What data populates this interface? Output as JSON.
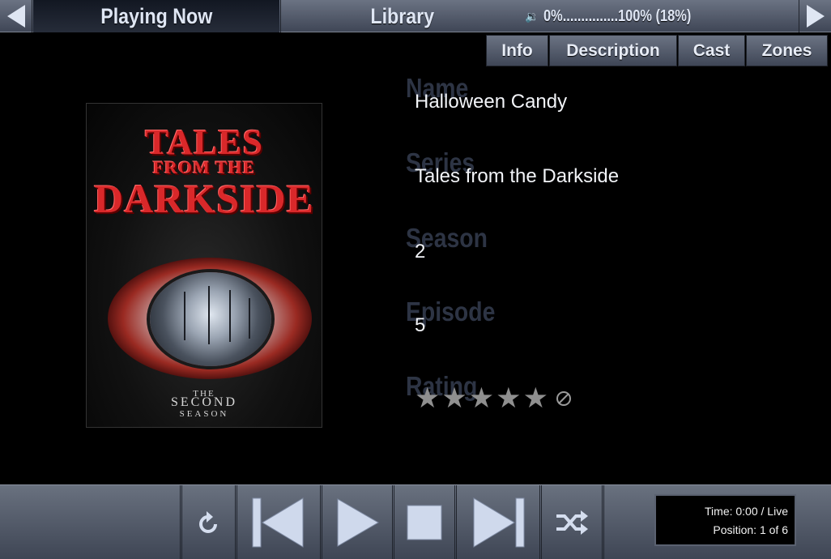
{
  "topbar": {
    "back_icon": "arrow-left-icon",
    "forward_icon": "arrow-right-icon",
    "tabs": [
      {
        "label": "Playing Now",
        "active": true
      },
      {
        "label": "Library",
        "active": false
      }
    ],
    "volume": {
      "icon": "speaker-icon",
      "text": "0%...............100%  (18%)",
      "level_percent": 18
    }
  },
  "subtabs": [
    "Info",
    "Description",
    "Cast",
    "Zones"
  ],
  "cover": {
    "title_line1": "TALES",
    "title_line2": "FROM THE",
    "title_line3": "DARKSIDE",
    "sub_line1": "THE",
    "sub_line2": "SECOND",
    "sub_line3": "SEASON"
  },
  "info": {
    "name_label": "Name",
    "name_value": "Halloween Candy",
    "series_label": "Series",
    "series_value": "Tales from the Darkside",
    "season_label": "Season",
    "season_value": "2",
    "episode_label": "Episode",
    "episode_value": "5",
    "rating_label": "Rating",
    "rating_stars_filled": 0,
    "rating_stars_total": 5
  },
  "transport": {
    "buttons": [
      "repeat-icon",
      "previous-icon",
      "play-icon",
      "stop-icon",
      "next-icon",
      "shuffle-icon"
    ],
    "time_text": "Time: 0:00 / Live",
    "position_text": "Position: 1 of 6"
  },
  "colors": {
    "bar_top": "#6b7383",
    "bar_bottom": "#3f4656",
    "label_dim": "#2d3444",
    "star_gray": "#8f8f8f",
    "cover_red": "#d9282a"
  }
}
